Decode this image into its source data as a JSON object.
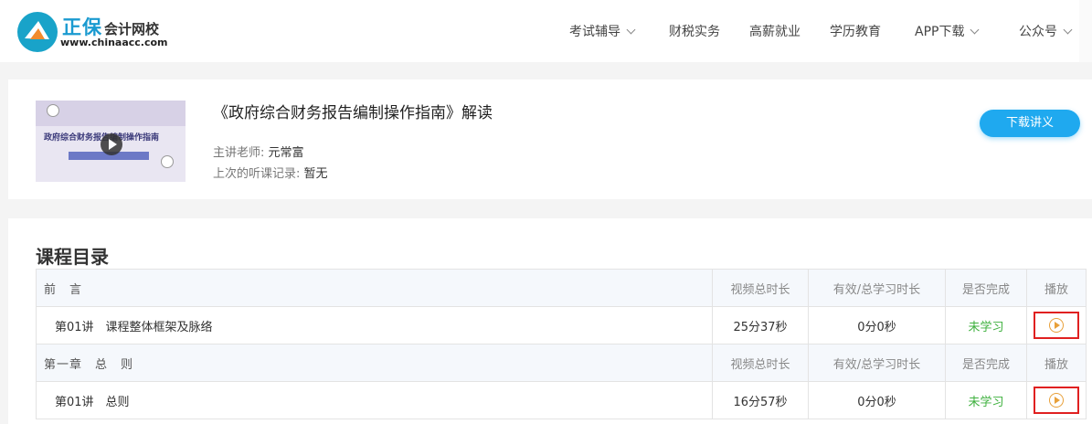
{
  "header": {
    "brand": "正保",
    "brand_sub": "会计网校",
    "url": "www.chinaacc.com",
    "nav": [
      "考试辅导",
      "财税实务",
      "高薪就业",
      "学历教育",
      "APP下载",
      "公众号"
    ]
  },
  "course": {
    "thumb_title": "政府综合财务报告编制操作指南",
    "title": "《政府综合财务报告编制操作指南》解读",
    "teacher_label": "主讲老师:",
    "teacher": "元常富",
    "record_label": "上次的听课记录:",
    "record": "暂无",
    "download_label": "下载讲义"
  },
  "catalog": {
    "title": "课程目录",
    "sections": [
      {
        "name": "前　言",
        "headers": [
          "视频总时长",
          "有效/总学习时长",
          "是否完成",
          "播放"
        ],
        "lectures": [
          {
            "name": "第01讲　课程整体框架及脉络",
            "duration": "25分37秒",
            "study": "0分0秒",
            "status": "未学习"
          }
        ]
      },
      {
        "name": "第一章　总　则",
        "headers": [
          "视频总时长",
          "有效/总学习时长",
          "是否完成",
          "播放"
        ],
        "lectures": [
          {
            "name": "第01讲　总则",
            "duration": "16分57秒",
            "study": "0分0秒",
            "status": "未学习"
          }
        ]
      }
    ]
  }
}
